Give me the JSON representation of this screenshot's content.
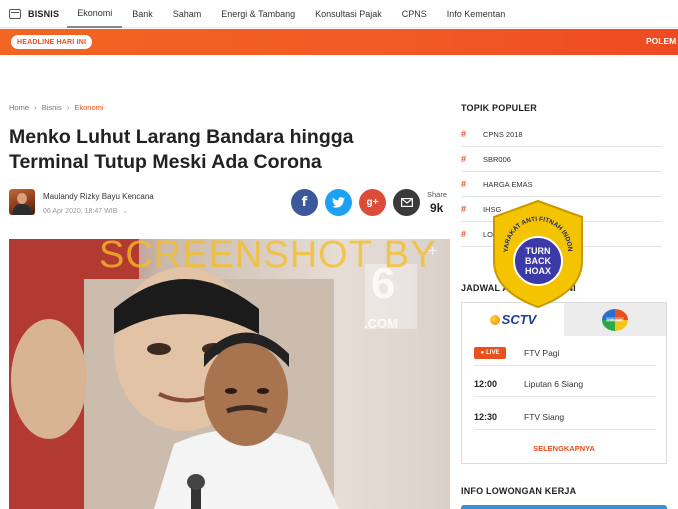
{
  "nav": {
    "brand": "BISNIS",
    "items": [
      "Ekonomi",
      "Bank",
      "Saham",
      "Energi & Tambang",
      "Konsultasi Pajak",
      "CPNS",
      "Info Kementan"
    ],
    "active_index": 0
  },
  "headline": {
    "pill": "HEADLINE HARI INI",
    "ticker": "POLEM"
  },
  "breadcrumb": {
    "home": "Home",
    "section": "Bisnis",
    "current": "Ekonomi"
  },
  "article": {
    "title": "Menko Luhut Larang Bandara hingga Terminal Tutup Meski Ada Corona",
    "author": "Maulandy Rizky Bayu Kencana",
    "date": "06 Apr 2020, 18:47 WIB"
  },
  "share": {
    "label": "Share",
    "count": "9k",
    "gplus_label": "g+"
  },
  "image": {
    "logo_number": "6",
    "logo_domain": ".COM"
  },
  "sidebar": {
    "popular_heading": "TOPIK POPULER",
    "topics": [
      "CPNS 2018",
      "SBR006",
      "HARGA EMAS",
      "IHSG",
      "LOWONGAN KERJA"
    ],
    "schedule_heading": "JADWAL ACARA HARI INI",
    "channels": [
      "SCTV",
      "Indosiar"
    ],
    "schedule": [
      {
        "time": "LIVE",
        "show": "FTV Pagi",
        "live": true
      },
      {
        "time": "12:00",
        "show": "Liputan 6 Siang",
        "live": false
      },
      {
        "time": "12:30",
        "show": "FTV Siang",
        "live": false
      }
    ],
    "more_link": "SELENGKAPNYA",
    "jobs_heading": "INFO LOWONGAN KERJA"
  },
  "watermark": {
    "text": "SCREENSHOT BY",
    "seal_top": "MASYARAKAT ANTI FITNAH INDONESIA",
    "seal_lines": [
      "TURN",
      "BACK",
      "HOAX"
    ]
  },
  "colors": {
    "accent": "#e8501e",
    "facebook": "#3b5998",
    "twitter": "#1da1f2",
    "gplus": "#dd4b39",
    "mail": "#3a3a3a",
    "watermark": "#f5be28"
  }
}
